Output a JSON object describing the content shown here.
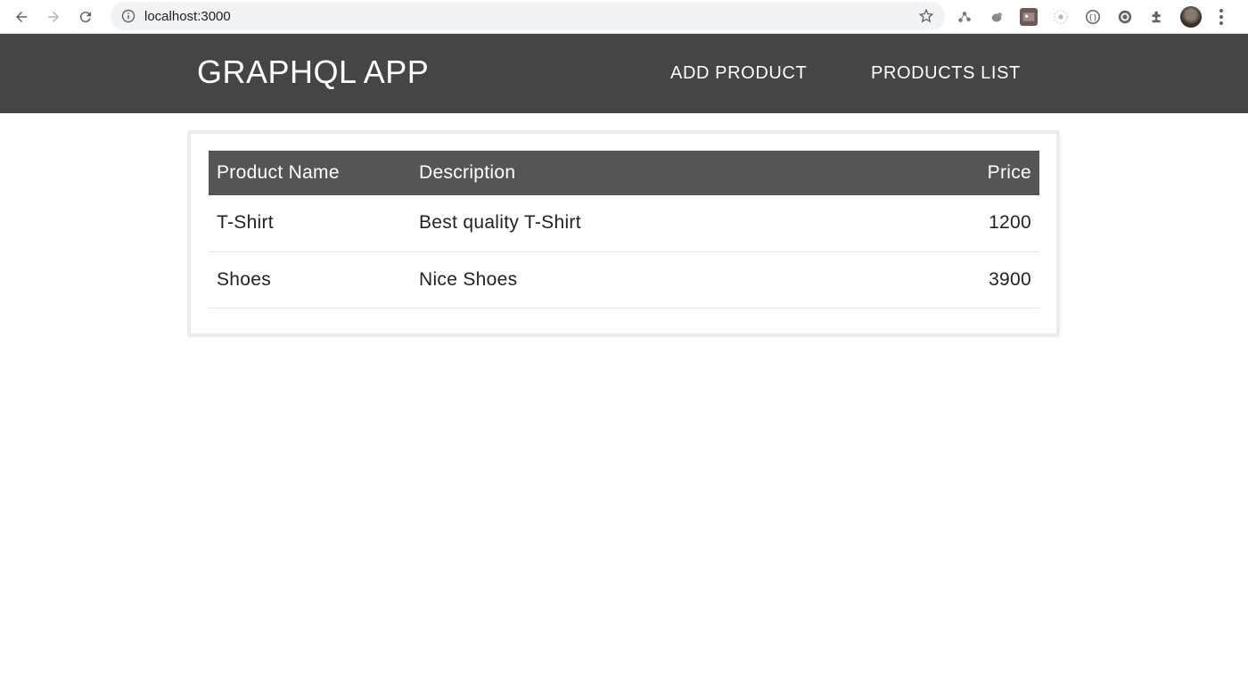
{
  "browser": {
    "url": "localhost:3000"
  },
  "app": {
    "title": "GRAPHQL APP",
    "nav": {
      "add_product": "ADD PRODUCT",
      "products_list": "PRODUCTS LIST"
    }
  },
  "table": {
    "headers": {
      "name": "Product Name",
      "description": "Description",
      "price": "Price"
    },
    "rows": [
      {
        "name": "T-Shirt",
        "description": "Best quality T-Shirt",
        "price": "1200"
      },
      {
        "name": "Shoes",
        "description": "Nice Shoes",
        "price": "3900"
      }
    ]
  },
  "colors": {
    "header_bg": "#454545",
    "table_header_bg": "#555555"
  }
}
